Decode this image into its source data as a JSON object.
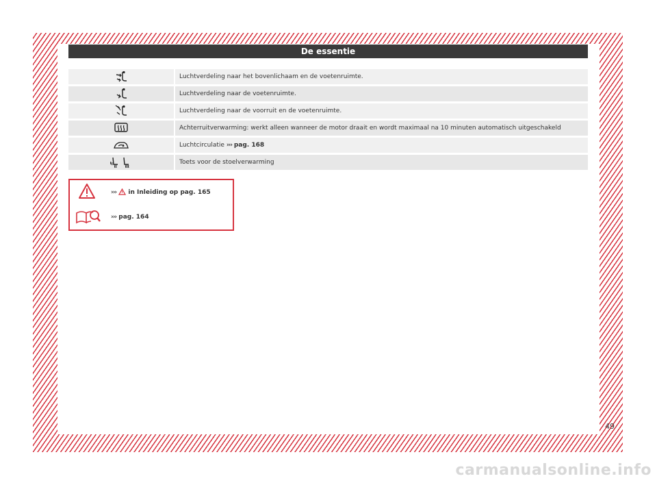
{
  "header": {
    "title": "De essentie"
  },
  "rows": [
    {
      "icon": "airflow-body-feet-icon",
      "text": "Luchtverdeling naar het bovenlichaam en de voetenruimte."
    },
    {
      "icon": "airflow-feet-icon",
      "text": "Luchtverdeling naar de voetenruimte."
    },
    {
      "icon": "airflow-windshield-feet-icon",
      "text": "Luchtverdeling naar de voorruit en de voetenruimte."
    },
    {
      "icon": "rear-window-heating-icon",
      "text": "Achterruitverwarming: werkt alleen wanneer de motor draait en wordt maximaal na 10 minuten automatisch uitgeschakeld"
    },
    {
      "icon": "air-recirculation-icon",
      "text": "Luchtcirculatie",
      "arrows": "›››",
      "ref": "pag. 168"
    },
    {
      "icon": "seat-heating-icon",
      "text": "Toets voor de stoelverwarming"
    }
  ],
  "references": {
    "warning": {
      "arrows": "›››",
      "text": "in Inleiding op pag. 165"
    },
    "book": {
      "arrows": "›››",
      "text": "pag. 164"
    }
  },
  "page_number": "49",
  "watermark": "carmanualsonline.info",
  "colors": {
    "accent": "#d6323e",
    "header_bg": "#3a3a3a",
    "row_bg": "#f0f0f0",
    "row_bg_alt": "#e7e7e7"
  }
}
